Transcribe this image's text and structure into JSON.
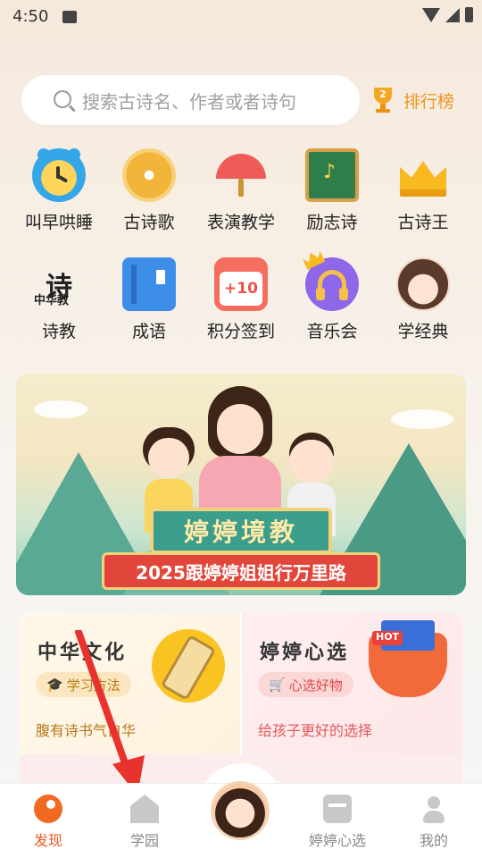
{
  "status_bar": {
    "time": "4:50"
  },
  "search": {
    "placeholder": "搜索古诗名、作者或者诗句"
  },
  "ranking": {
    "label": "排行榜"
  },
  "grid_row1": [
    {
      "label": "叫早哄睡",
      "icon": "alarm-clock-icon"
    },
    {
      "label": "古诗歌",
      "icon": "music-disc-icon"
    },
    {
      "label": "表演教学",
      "icon": "fan-icon"
    },
    {
      "label": "励志诗",
      "icon": "blackboard-icon"
    },
    {
      "label": "古诗王",
      "icon": "crown-icon"
    }
  ],
  "grid_row2": [
    {
      "label": "诗教",
      "icon": "poem-logo-icon",
      "logo_text": "诗",
      "logo_small": "中华教"
    },
    {
      "label": "成语",
      "icon": "book-icon"
    },
    {
      "label": "积分签到",
      "icon": "calendar-icon",
      "badge": "+10"
    },
    {
      "label": "音乐会",
      "icon": "headphones-icon"
    },
    {
      "label": "学经典",
      "icon": "girl-avatar-icon"
    }
  ],
  "banner": {
    "title": "婷婷境教",
    "subtitle": "2025跟婷婷姐姐行万里路"
  },
  "cards": {
    "left": {
      "title": "中华文化",
      "tag": "学习方法",
      "desc": "腹有诗书气自华"
    },
    "right": {
      "title": "婷婷心选",
      "tag": "心选好物",
      "desc": "给孩子更好的选择",
      "hot": "HOT"
    }
  },
  "tabbar": {
    "tabs": [
      {
        "label": "发现",
        "icon": "discover-icon",
        "active": true
      },
      {
        "label": "学园",
        "icon": "school-icon",
        "active": false
      },
      {
        "label": "",
        "icon": "center-avatar-icon",
        "active": false
      },
      {
        "label": "婷婷心选",
        "icon": "shop-icon",
        "active": false
      },
      {
        "label": "我的",
        "icon": "profile-icon",
        "active": false
      }
    ]
  },
  "colors": {
    "accent": "#f0541a",
    "ranking": "#f0931a",
    "arrow": "#e8322d"
  }
}
